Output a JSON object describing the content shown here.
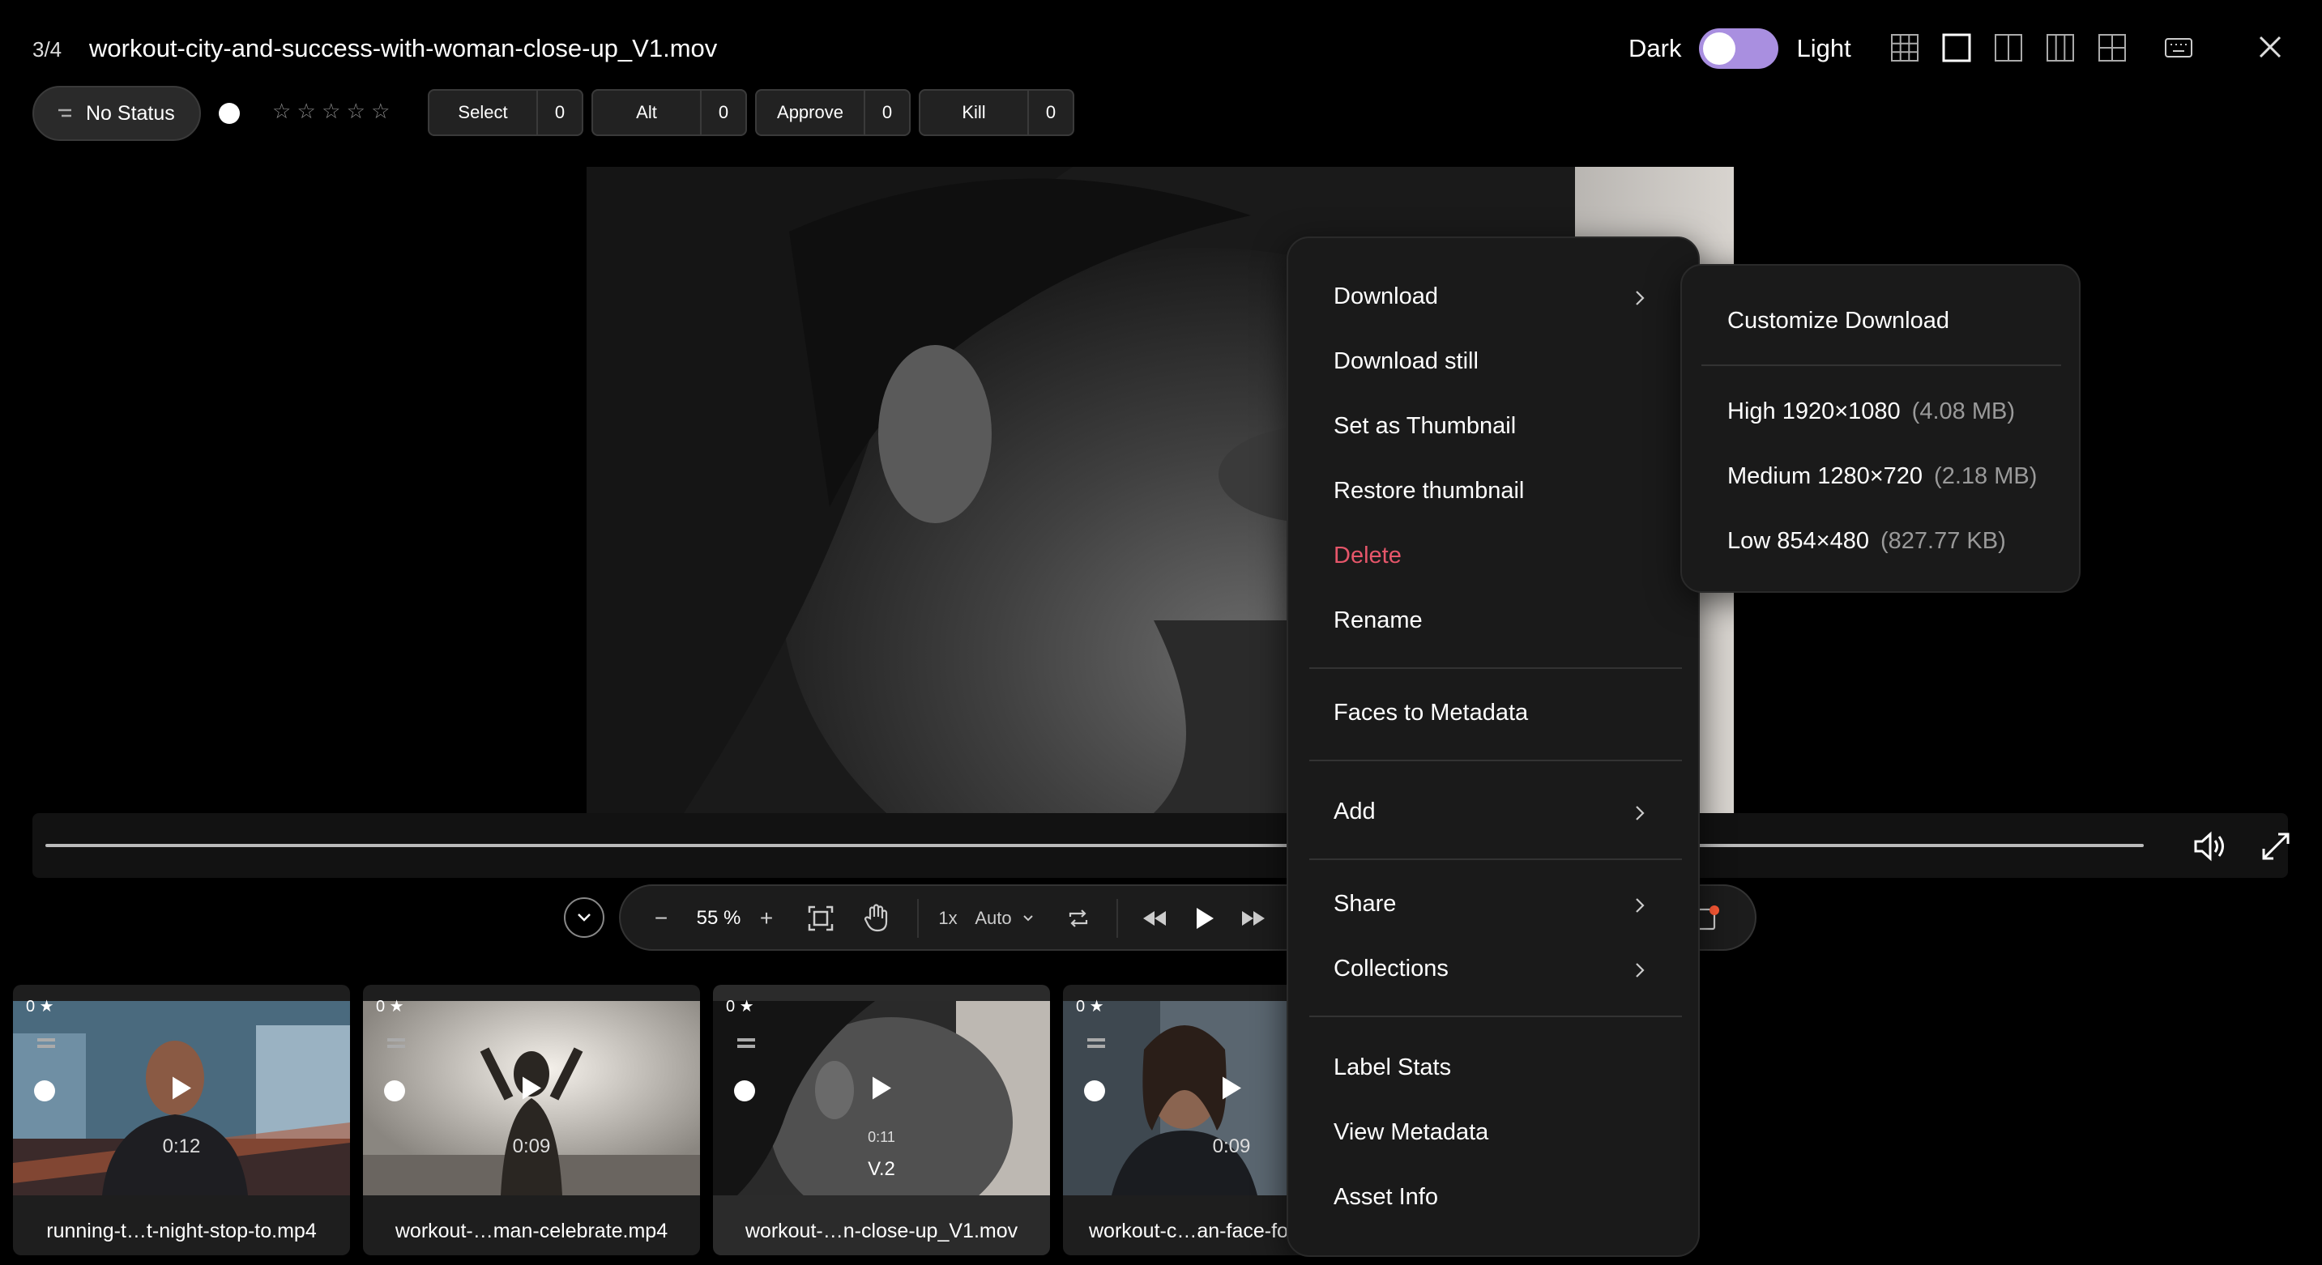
{
  "header": {
    "counter": "3/4",
    "filename": "workout-city-and-success-with-woman-close-up_V1.mov",
    "theme_dark": "Dark",
    "theme_light": "Light"
  },
  "status": {
    "label": "No Status",
    "rating_stars": "☆ ☆ ☆ ☆ ☆"
  },
  "label_buttons": [
    {
      "label": "Select",
      "count": "0"
    },
    {
      "label": "Alt",
      "count": "0"
    },
    {
      "label": "Approve",
      "count": "0"
    },
    {
      "label": "Kill",
      "count": "0"
    }
  ],
  "controls": {
    "zoom_minus": "−",
    "zoom_value": "55 %",
    "zoom_plus": "+",
    "speed": "1x",
    "quality": "Auto"
  },
  "thumbnails": [
    {
      "count": "0 ★",
      "duration": "0:12",
      "version": "",
      "name": "running-t…t-night-stop-to.mp4"
    },
    {
      "count": "0 ★",
      "duration": "0:09",
      "version": "",
      "name": "workout-…man-celebrate.mp4"
    },
    {
      "count": "0 ★",
      "duration": "0:11",
      "version": "V.2",
      "name": "workout-…n-close-up_V1.mov"
    },
    {
      "count": "0 ★",
      "duration": "0:09",
      "version": "",
      "name": "workout-c…an-face-fo"
    }
  ],
  "context_menu": {
    "download": "Download",
    "download_still": "Download still",
    "set_thumbnail": "Set as Thumbnail",
    "restore_thumbnail": "Restore thumbnail",
    "delete": "Delete",
    "rename": "Rename",
    "faces_to_metadata": "Faces to Metadata",
    "add": "Add",
    "share": "Share",
    "collections": "Collections",
    "label_stats": "Label Stats",
    "view_metadata": "View Metadata",
    "asset_info": "Asset Info"
  },
  "download_submenu": {
    "customize": "Customize Download",
    "high_label": "High 1920×1080",
    "high_size": "(4.08 MB)",
    "medium_label": "Medium 1280×720",
    "medium_size": "(2.18 MB)",
    "low_label": "Low 854×480",
    "low_size": "(827.77 KB)"
  },
  "colors": {
    "accent_toggle": "#a98fe0",
    "danger": "#e6566a",
    "notification": "#ff5a36"
  }
}
